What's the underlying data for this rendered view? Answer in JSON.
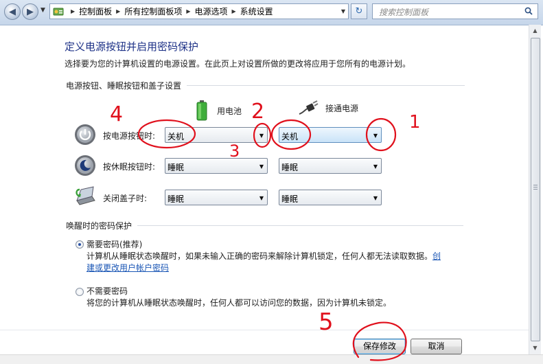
{
  "address_bar": {
    "breadcrumbs": [
      "控制面板",
      "所有控制面板项",
      "电源选项",
      "系统设置"
    ],
    "search_placeholder": "搜索控制面板"
  },
  "page": {
    "title": "定义电源按钮并启用密码保护",
    "subtitle": "选择要为您的计算机设置的电源设置。在此页上对设置所做的更改将应用于您所有的电源计划。"
  },
  "buttons_section": {
    "heading": "电源按钮、睡眠按钮和盖子设置",
    "columns": {
      "battery": "用电池",
      "plugged": "接通电源"
    },
    "rows": [
      {
        "label": "按电源按钮时:",
        "battery": "关机",
        "plugged": "关机",
        "icon": "power-icon"
      },
      {
        "label": "按休眠按钮时:",
        "battery": "睡眠",
        "plugged": "睡眠",
        "icon": "sleep-icon"
      },
      {
        "label": "关闭盖子时:",
        "battery": "睡眠",
        "plugged": "睡眠",
        "icon": "laptop-lid-icon"
      }
    ]
  },
  "password_section": {
    "heading": "唤醒时的密码保护",
    "option_require": {
      "label": "需要密码(推荐)",
      "desc": "计算机从睡眠状态唤醒时，如果未输入正确的密码来解除计算机锁定，任何人都无法读取数据。",
      "link": "创建或更改用户帐户密码",
      "selected": true
    },
    "option_none": {
      "label": "不需要密码",
      "desc": "将您的计算机从睡眠状态唤醒时，任何人都可以访问您的数据，因为计算机未锁定。",
      "selected": false
    }
  },
  "footer": {
    "save": "保存修改",
    "cancel": "取消"
  },
  "annotations": [
    "4",
    "2",
    "3",
    "1",
    "5"
  ],
  "colors": {
    "title": "#1e3287",
    "link": "#1a56b5",
    "annotation": "#e0101c"
  }
}
